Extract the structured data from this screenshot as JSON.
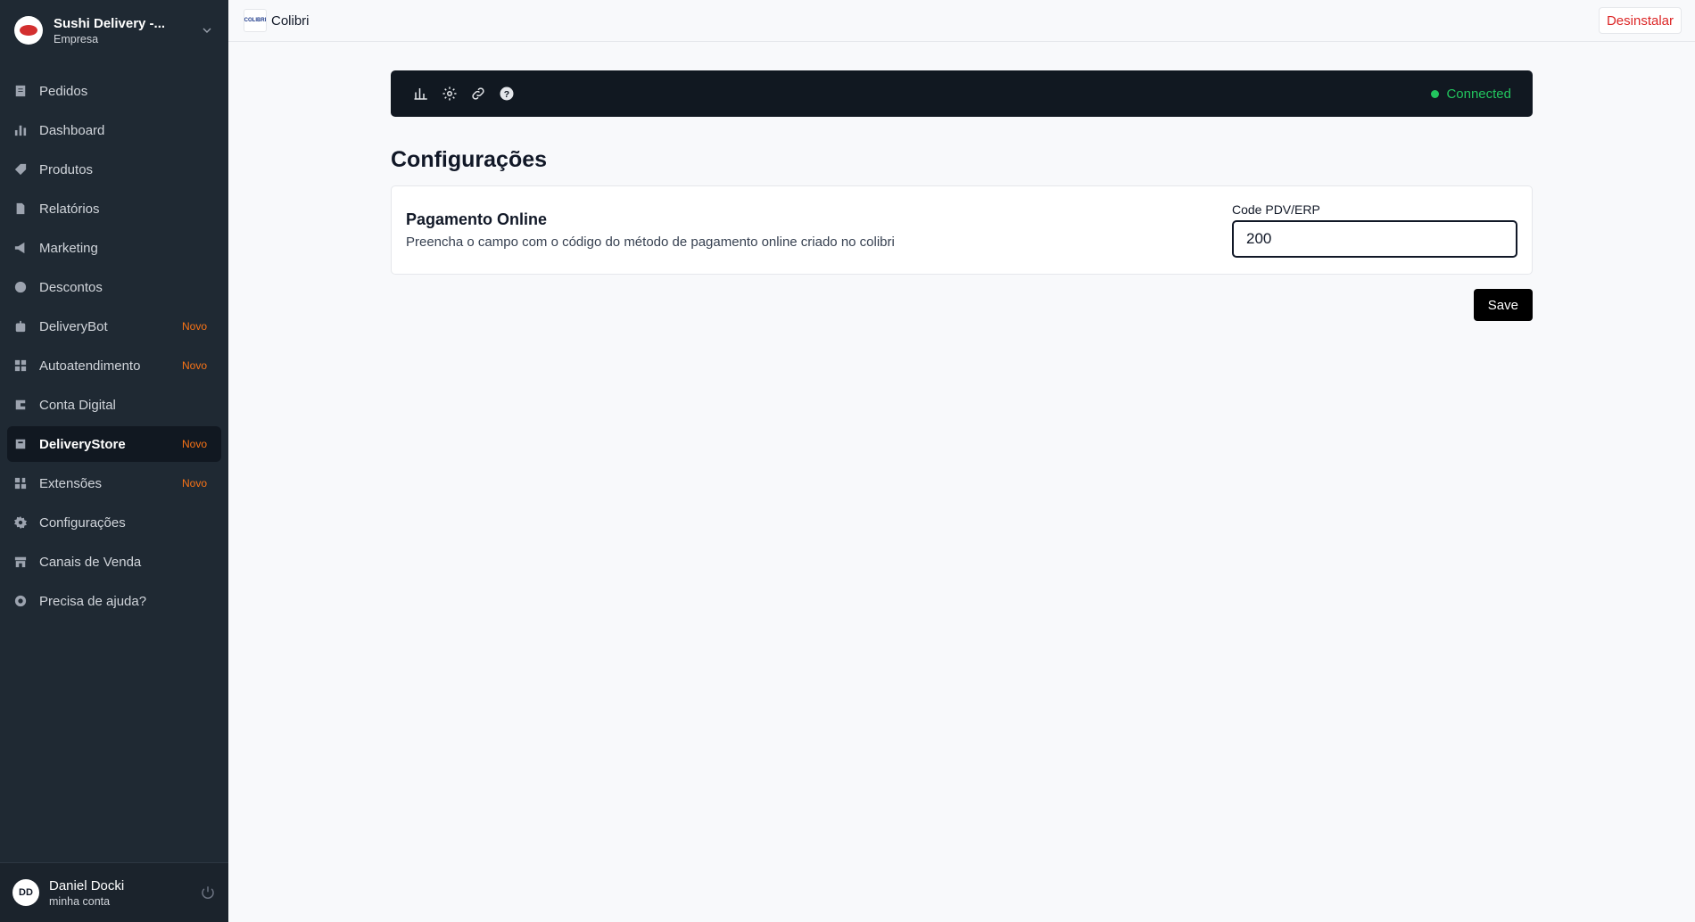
{
  "company": {
    "name": "Sushi Delivery -...",
    "subtitle": "Empresa",
    "logo_icon": "sushi-logo",
    "dropdown_icon": "chevron-down-icon"
  },
  "sidebar": {
    "items": [
      {
        "label": "Pedidos",
        "icon": "orders-icon",
        "badge": ""
      },
      {
        "label": "Dashboard",
        "icon": "bar-chart-icon",
        "badge": ""
      },
      {
        "label": "Produtos",
        "icon": "tag-icon",
        "badge": ""
      },
      {
        "label": "Relatórios",
        "icon": "document-icon",
        "badge": ""
      },
      {
        "label": "Marketing",
        "icon": "megaphone-icon",
        "badge": ""
      },
      {
        "label": "Descontos",
        "icon": "discount-icon",
        "badge": ""
      },
      {
        "label": "DeliveryBot",
        "icon": "bot-icon",
        "badge": "Novo"
      },
      {
        "label": "Autoatendimento",
        "icon": "grid-icon",
        "badge": "Novo"
      },
      {
        "label": "Conta Digital",
        "icon": "wallet-icon",
        "badge": ""
      },
      {
        "label": "DeliveryStore",
        "icon": "store-bag-icon",
        "badge": "Novo",
        "active": true
      },
      {
        "label": "Extensões",
        "icon": "extensions-icon",
        "badge": "Novo"
      },
      {
        "label": "Configurações",
        "icon": "gear-icon",
        "badge": ""
      },
      {
        "label": "Canais de Venda",
        "icon": "storefront-icon",
        "badge": ""
      },
      {
        "label": "Precisa de ajuda?",
        "icon": "lifebuoy-icon",
        "badge": ""
      }
    ],
    "badge_color": "#f97316"
  },
  "user": {
    "initials": "DD",
    "name": "Daniel Docki",
    "subtitle": "minha conta"
  },
  "topbar": {
    "app_title": "Colibri",
    "app_logo_text": "COLIBRI",
    "uninstall_label": "Desinstalar"
  },
  "toolbar": {
    "icons": [
      "bar-chart-icon",
      "gear-icon",
      "link-icon",
      "help-icon"
    ],
    "status_label": "Connected",
    "status_color": "#22c55e"
  },
  "main": {
    "title": "Configurações",
    "card": {
      "title": "Pagamento Online",
      "description": "Preencha o campo com o código do método de pagamento online criado no colibri",
      "field_label": "Code PDV/ERP",
      "field_value": "200"
    },
    "save_label": "Save"
  }
}
